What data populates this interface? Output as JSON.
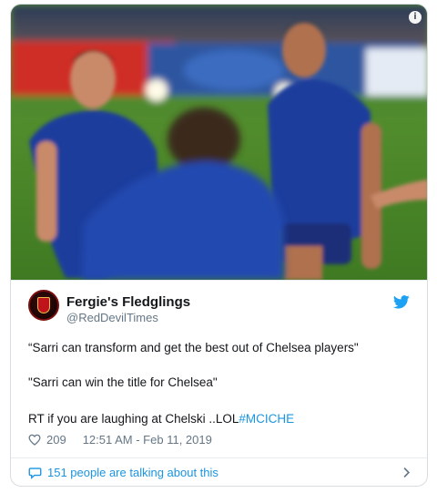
{
  "tweet": {
    "info_glyph": "i",
    "author_name": "Fergie's Fledglings",
    "author_handle": "@RedDevilTimes",
    "lines": [
      "“Sarri can transform and get the best out of Chelsea players\"",
      "\"Sarri can win the title for Chelsea\""
    ],
    "line3_text": "RT if you are laughing at Chelski ..LOL",
    "hashtag": "#MCICHE",
    "likes": "209",
    "timestamp": "12:51 AM - Feb 11, 2019",
    "talking": "151 people are talking about this"
  },
  "icons": {
    "info": "info-icon",
    "avatar": "avatar-crest",
    "brand": "twitter-bird-icon",
    "like": "heart-icon",
    "conversation": "speech-bubble-icon",
    "more": "chevron-right-icon"
  },
  "colors": {
    "accent": "#1b95e0",
    "muted": "#657786",
    "text": "#14171a",
    "border": "#d8dde2"
  }
}
